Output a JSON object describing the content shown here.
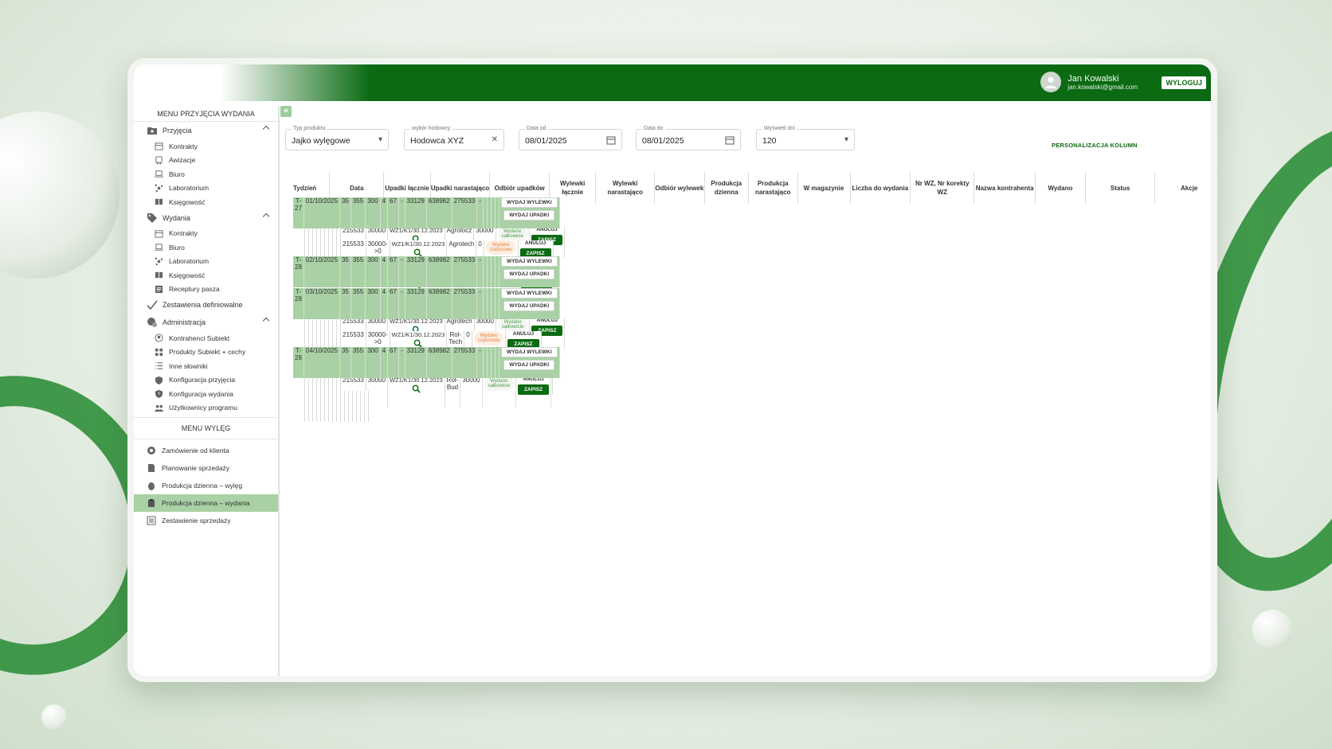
{
  "header": {
    "user_name": "Jan Kowalski",
    "user_email": "jan.kowalski@gmail.com",
    "logout": "WYLOGUJ"
  },
  "sidebar": {
    "title": "MENU PRZYJĘCIA WYDANIA",
    "przyjecia": {
      "label": "Przyjęcia",
      "items": [
        "Kontrakty",
        "Awizacje",
        "Biuro",
        "Laboratorium",
        "Księgowość"
      ]
    },
    "wydania": {
      "label": "Wydania",
      "items": [
        "Kontrakty",
        "Biuro",
        "Laboratorium",
        "Księgowość",
        "Receptury pasza"
      ]
    },
    "zestawienia": "Zestawienia definiowalne",
    "administracja": {
      "label": "Administracja",
      "items": [
        "Kontrahenci Subiekt",
        "Produkty Subiekt + cechy",
        "Inne słowniki",
        "Konfiguracja przyjęcia",
        "Konfiguracja wydania",
        "Użytkownicy programu"
      ]
    },
    "menu2_title": "MENU WYLĘG",
    "menu2": [
      "Zamówienie od klienta",
      "Planowanie sprzedaży",
      "Produkcja dzienna – wylęg",
      "Produkcja dzienna – wydania",
      "Zestawienie sprzedaży"
    ]
  },
  "filters": {
    "typ_label": "Typ produktu",
    "typ_value": "Jajko wylęgowe",
    "hod_label": "wybór hodowcy",
    "hod_value": "Hodowca XYZ",
    "od_label": "Data od",
    "od_value": "08/01/2025",
    "do_label": "Data do",
    "do_value": "08/01/2025",
    "dni_label": "Wyświetl dni",
    "dni_value": "120",
    "personalizacja": "PERSONALIZACJA KOLUMN"
  },
  "table": {
    "headers": [
      "Tydzień",
      "Data",
      "Upadki łącznie",
      "Upadki narastająco",
      "Odbiór upadków",
      "Wylewki łącznie",
      "Wylewki narastająco",
      "Odbiór wylewek",
      "Produkcja dzienna",
      "Produkcja narastająco",
      "W magazynie",
      "Liczba do wydania",
      "Nr WZ, Nr korekty WZ",
      "Nazwa kontrahenta",
      "Wydano",
      "Status",
      "Akcje"
    ],
    "btn_wylewki": "WYDAJ WYLEWKI",
    "btn_upadki": "WYDAJ UPADKI",
    "btn_anuluj": "ANULUJ",
    "btn_zapisz": "ZAPISZ",
    "rows": [
      {
        "type": "group",
        "cells": [
          "T-27",
          "01/10/2025",
          "35",
          "355",
          "300",
          "4",
          "67",
          "-",
          "33129",
          "638982",
          "275533",
          "-"
        ]
      },
      {
        "type": "sub",
        "mag": "245533",
        "liczba": "30000",
        "wz": "WZ1/K1/30.12.2023",
        "kontrahent": "KPW",
        "wydano": "30000",
        "status": "Wydano całkowicie",
        "partial": false
      },
      {
        "type": "sub",
        "mag": "215533",
        "liczba": "30000",
        "wz": "WZ1/K1/30.12.2023",
        "kontrahent": "Agrotocz",
        "wydano": "30000",
        "status": "Wydano całkowicie",
        "partial": false
      },
      {
        "type": "sub",
        "mag": "215533",
        "liczba": "30000->0",
        "wz": "WZ1/K1/30.12.2023",
        "kontrahent": "Agrotech",
        "wydano": "0",
        "status": "Wydano częściowo",
        "partial": true
      },
      {
        "type": "group",
        "cells": [
          "T-28",
          "02/10/2025",
          "35",
          "355",
          "300",
          "4",
          "67",
          "-",
          "33129",
          "638982",
          "275533",
          "-"
        ]
      },
      {
        "type": "sub",
        "mag": "245533",
        "liczba": "30000",
        "wz": "WZ1/K1/30.12.2023",
        "kontrahent": "KPW",
        "wydano": "30000",
        "status": "Wydano całkowicie",
        "partial": false
      },
      {
        "type": "group",
        "cells": [
          "T-28",
          "03/10/2025",
          "35",
          "355",
          "300",
          "4",
          "67",
          "-",
          "33129",
          "638982",
          "275533",
          "-"
        ]
      },
      {
        "type": "sub",
        "mag": "245533",
        "liczba": "30000",
        "wz": "WZ1/K1/30.12.2023",
        "kontrahent": "KPW",
        "wydano": "30000",
        "status": "Wydano całkowicie",
        "partial": false
      },
      {
        "type": "sub",
        "mag": "215533",
        "liczba": "30000",
        "wz": "WZ1/K1/30.12.2023",
        "kontrahent": "Agrotech",
        "wydano": "30000",
        "status": "Wydano całkowicie",
        "partial": false
      },
      {
        "type": "sub",
        "mag": "215533",
        "liczba": "30000->0",
        "wz": "WZ1/K1/30.12.2023",
        "kontrahent": "Rol-Tech",
        "wydano": "0",
        "status": "Wydano częściowo",
        "partial": true
      },
      {
        "type": "group",
        "cells": [
          "T-28",
          "04/10/2025",
          "35",
          "355",
          "300",
          "4",
          "67",
          "-",
          "33129",
          "638982",
          "275533",
          "-"
        ]
      },
      {
        "type": "sub",
        "mag": "245533",
        "liczba": "30000",
        "wz": "WZ1/K1/30.12.2023",
        "kontrahent": "POS",
        "wydano": "30000",
        "status": "Wydano całkowicie",
        "partial": false
      },
      {
        "type": "sub",
        "mag": "215533",
        "liczba": "30000",
        "wz": "WZ1/K1/30.12.2023",
        "kontrahent": "Rol-Bud",
        "wydano": "30000",
        "status": "Wydano całkowicie",
        "partial": false
      }
    ]
  },
  "colors": {
    "primary": "#0b6a12",
    "group_row": "#a9d1a5",
    "status_full": "#3f9b46",
    "status_partial": "#e07d34"
  }
}
